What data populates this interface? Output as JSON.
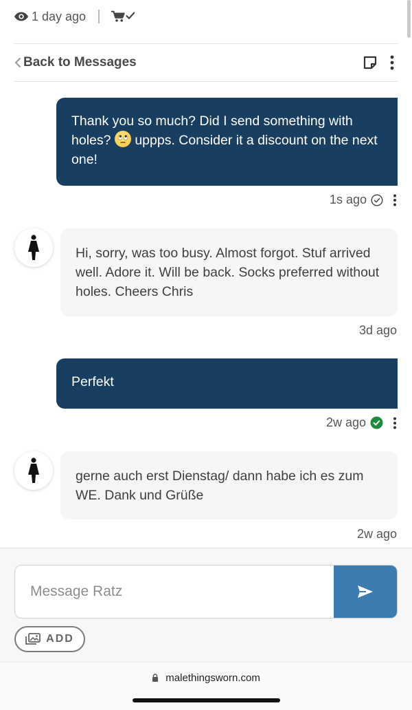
{
  "top": {
    "views_label": "1 day ago"
  },
  "header": {
    "back_label": "Back to Messages"
  },
  "messages": [
    {
      "direction": "outgoing",
      "text_before_emoji": "Thank you so much? Did I send something with holes?",
      "emoji": "face-with-rolling-eyes",
      "text_after_emoji": "uppps. Consider it a discount on the next one!",
      "time": "1s ago",
      "status": "sent"
    },
    {
      "direction": "incoming",
      "text": "Hi, sorry, was too busy. Almost forgot. Stuf arrived well. Adore it. Will be back. Socks preferred without holes. Cheers Chris",
      "time": "3d ago"
    },
    {
      "direction": "outgoing",
      "text": "Perfekt",
      "time": "2w ago",
      "status": "read"
    },
    {
      "direction": "incoming",
      "text": "gerne auch erst Dienstag/ dann habe ich es zum WE. Dank und Grüße",
      "time": "2w ago"
    }
  ],
  "composer": {
    "placeholder": "Message Ratz",
    "add_label": "ADD"
  },
  "browser": {
    "url": "malethingsworn.com"
  },
  "colors": {
    "outgoing_bubble": "#183f62",
    "incoming_bubble": "#f5f6f7",
    "send_button": "#3d7cb0",
    "read_check": "#1e8a3c"
  }
}
